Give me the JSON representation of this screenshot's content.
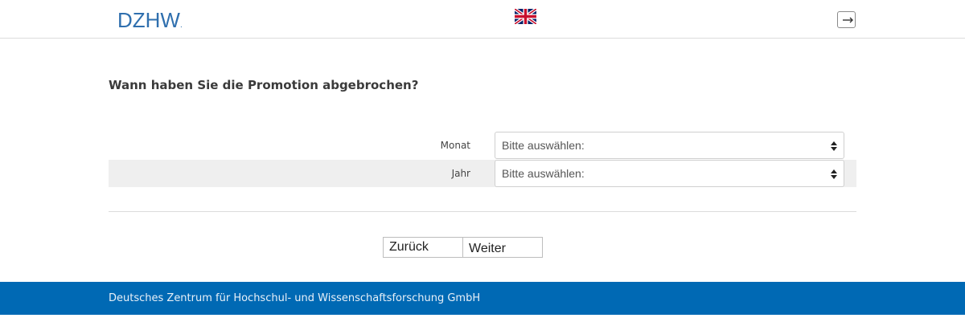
{
  "header": {
    "logo_text": "DZHW",
    "logo_dot": ".",
    "language_flag_icon": "uk-flag-icon",
    "logout_icon": "logout-icon"
  },
  "question": {
    "text": "Wann haben Sie die Promotion abgebrochen?"
  },
  "fields": [
    {
      "label": "Monat",
      "value": "Bitte auswählen:"
    },
    {
      "label": "Jahr",
      "value": "Bitte auswählen:"
    }
  ],
  "buttons": {
    "back_label": "Zurück",
    "next_label": "Weiter"
  },
  "footer": {
    "text": "Deutsches Zentrum für Hochschul- und Wissenschaftsforschung GmbH"
  },
  "colors": {
    "brand_blue": "#2f6fae",
    "footer_blue": "#0069b4",
    "alt_row": "#efefef"
  }
}
